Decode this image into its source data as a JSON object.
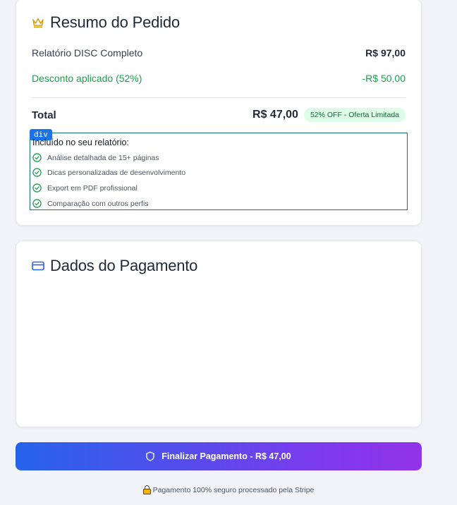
{
  "summary": {
    "title": "Resumo do Pedido",
    "title_icon": "crown-icon",
    "item_label": "Relatório DISC Completo",
    "item_price": "R$ 97,00",
    "discount_label": "Desconto aplicado (52%)",
    "discount_value": "-R$ 50,00",
    "total_label": "Total",
    "total_value": "R$ 47,00",
    "badge": "52% OFF - Oferta Limitada"
  },
  "included": {
    "dev_tag": "div",
    "title": "Incluído no seu relatório:",
    "features": [
      "Análise detalhada de 15+ páginas",
      "Dicas personalizadas de desenvolvimento",
      "Export em PDF profissional",
      "Comparação com outros perfis"
    ]
  },
  "payment": {
    "title": "Dados do Pagamento",
    "title_icon": "credit-card-icon"
  },
  "cta": {
    "label": "Finalizar Pagamento - R$ 47,00",
    "icon": "shield-icon"
  },
  "footer": {
    "secure_text": "Pagamento 100% seguro processado pela Stripe",
    "icon": "lock-icon"
  },
  "colors": {
    "accent_green": "#16a34a",
    "badge_bg": "#dcfce7",
    "crown": "#d4a017",
    "card_icon": "#2563eb",
    "button_gradient_start": "#2563eb",
    "button_gradient_end": "#9333ea"
  }
}
